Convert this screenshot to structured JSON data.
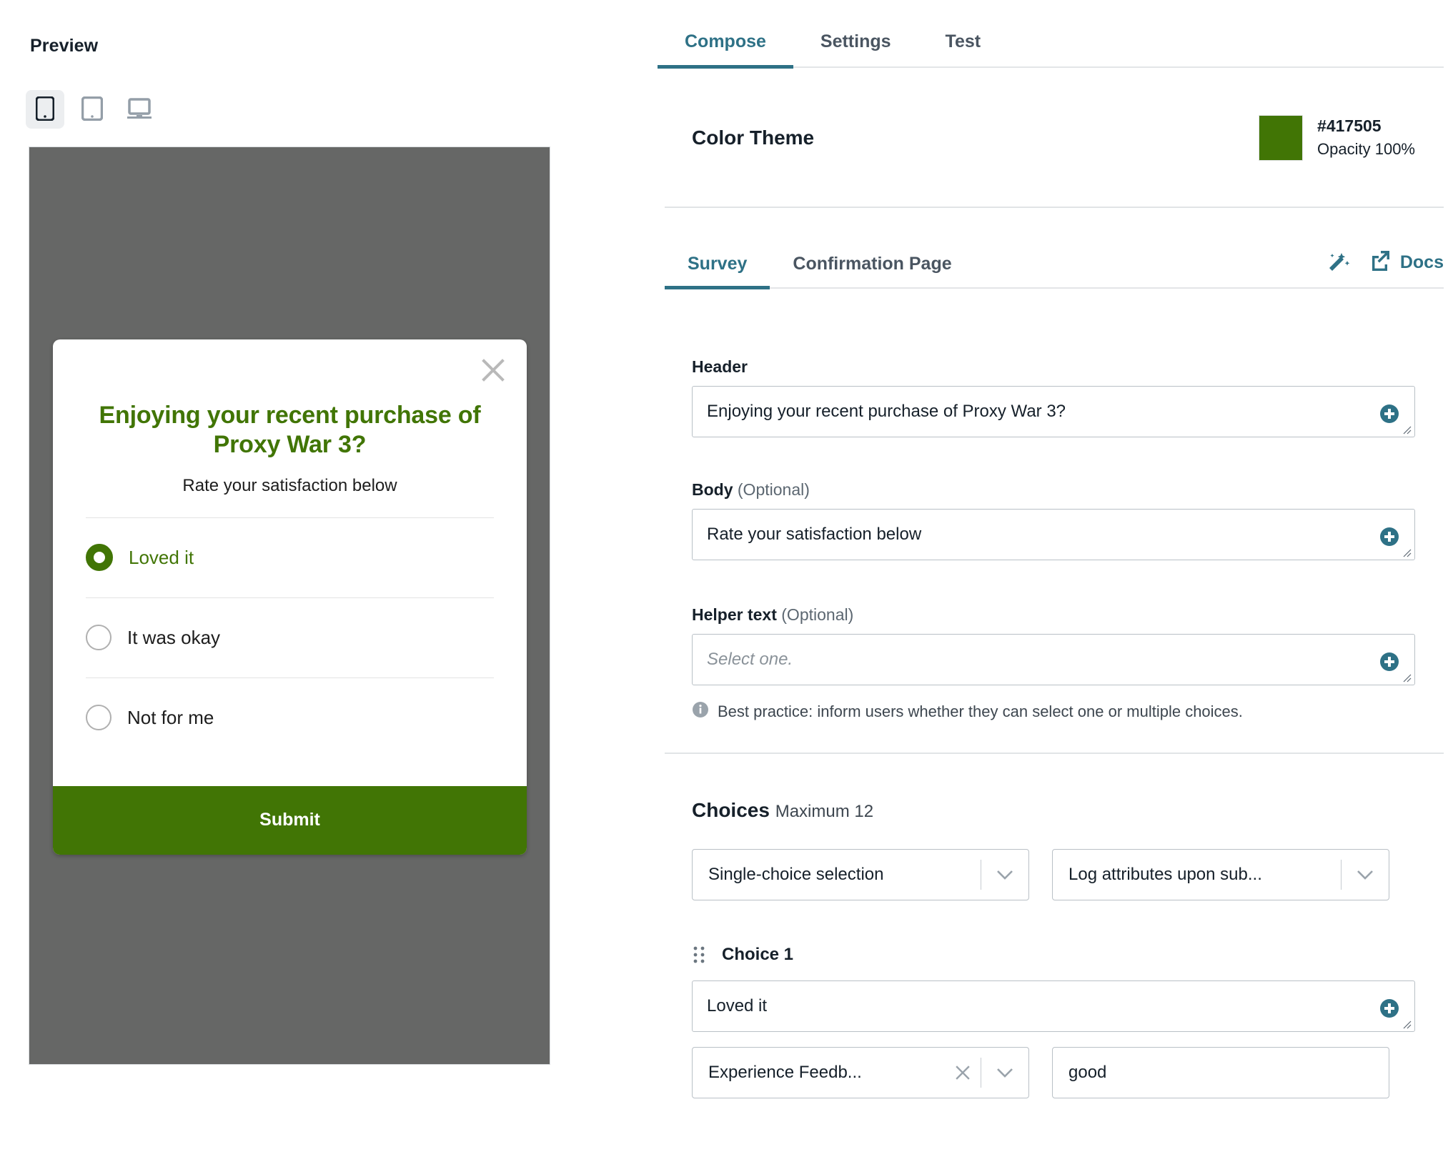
{
  "preview": {
    "title": "Preview",
    "devices": [
      {
        "name": "mobile-device-icon",
        "label": "Mobile",
        "active": true
      },
      {
        "name": "tablet-device-icon",
        "label": "Tablet",
        "active": false
      },
      {
        "name": "desktop-device-icon",
        "label": "Desktop",
        "active": false
      }
    ],
    "survey": {
      "close_label": "×",
      "header": "Enjoying your recent purchase of Proxy War 3?",
      "body": "Rate your satisfaction below",
      "choices": [
        {
          "label": "Loved it",
          "selected": true
        },
        {
          "label": "It was okay",
          "selected": false
        },
        {
          "label": "Not for me",
          "selected": false
        }
      ],
      "submit_label": "Submit"
    }
  },
  "editor": {
    "top_tabs": [
      {
        "label": "Compose",
        "active": true
      },
      {
        "label": "Settings",
        "active": false
      },
      {
        "label": "Test",
        "active": false
      }
    ],
    "color_theme": {
      "label": "Color Theme",
      "hex": "#417505",
      "opacity": "Opacity 100%"
    },
    "sub_tabs": [
      {
        "label": "Survey",
        "active": true
      },
      {
        "label": "Confirmation Page",
        "active": false
      }
    ],
    "actions": {
      "magic_wand": "magic-wand-icon",
      "docs_label": "Docs"
    },
    "fields": {
      "header": {
        "label": "Header",
        "optional": "",
        "value": "Enjoying your recent purchase of Proxy War 3?",
        "placeholder": ""
      },
      "body": {
        "label": "Body",
        "optional": "(Optional)",
        "value": "Rate your satisfaction below",
        "placeholder": ""
      },
      "helper": {
        "label": "Helper text",
        "optional": "(Optional)",
        "value": "",
        "placeholder": "Select one.",
        "hint": "Best practice: inform users whether they can select one or multiple choices."
      }
    },
    "choices": {
      "title": "Choices",
      "maximum": "Maximum 12",
      "selection_mode": "Single-choice selection",
      "logging_mode": "Log attributes upon sub...",
      "choice_number_label": "Choice 1",
      "choice_value": "Loved it",
      "attribute_name": "Experience Feedb...",
      "attribute_value": "good"
    }
  }
}
